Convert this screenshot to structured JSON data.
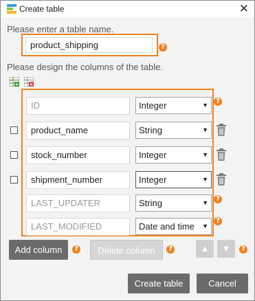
{
  "window": {
    "title": "Create table",
    "close_glyph": "✕"
  },
  "table_name": {
    "prompt": "Please enter a table name.",
    "value": "product_shipping"
  },
  "columns_prompt": "Please design the columns of the table.",
  "columns": [
    {
      "name": "ID",
      "type": "Integer",
      "checkbox": false,
      "deletable": false,
      "system": true
    },
    {
      "name": "product_name",
      "type": "String",
      "checkbox": true,
      "deletable": true,
      "system": false
    },
    {
      "name": "stock_number",
      "type": "Integer",
      "checkbox": true,
      "deletable": true,
      "system": false
    },
    {
      "name": "shipment_number",
      "type": "Integer",
      "checkbox": true,
      "deletable": true,
      "system": false
    },
    {
      "name": "LAST_UPDATER",
      "type": "String",
      "checkbox": false,
      "deletable": false,
      "system": true
    },
    {
      "name": "LAST_MODIFIED",
      "type": "Date and time",
      "checkbox": false,
      "deletable": false,
      "system": true
    }
  ],
  "buttons": {
    "add_column": "Add column",
    "delete_column": "Delete column",
    "move_up": "▲",
    "move_down": "▼",
    "create_table": "Create table",
    "cancel": "Cancel"
  },
  "help_glyph": "?",
  "dropdown_glyph": "▼",
  "icons": {
    "app": "create-table-app-icon",
    "add_rows": "add-rows-icon",
    "delete_rows": "delete-rows-icon",
    "trash": "trash-icon",
    "help": "help-icon"
  },
  "colors": {
    "accent": "#f0801e",
    "primary_button": "#6b6b6b",
    "disabled_button": "#d6d6d6"
  }
}
